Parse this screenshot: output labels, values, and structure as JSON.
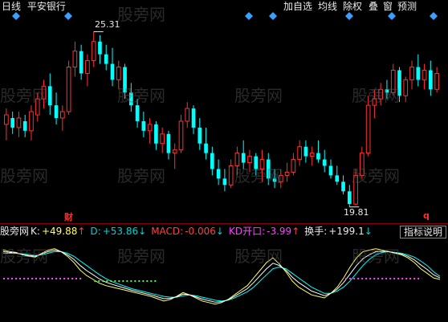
{
  "header": {
    "period_label": "日线",
    "stock_name": "平安银行",
    "buttons": [
      "加自选",
      "均线",
      "除权",
      "叠",
      "窗",
      "预测"
    ]
  },
  "price_marks": {
    "high_label": "25.31",
    "low_label": "19.81"
  },
  "signal_labels": {
    "left": "财",
    "right": "q"
  },
  "indicator": {
    "source": "股旁网",
    "k_label": "K:",
    "k_value": "+49.88",
    "d_label": "D:",
    "d_value": "+53.86",
    "macd_label": "MACD:",
    "macd_value": "-0.006",
    "kd_label": "KD开口:",
    "kd_value": "-3.99",
    "turnover_label": "换手:",
    "turnover_value": "+199.1",
    "explain_button": "指标说明"
  },
  "watermark": "股旁网",
  "colors": {
    "background": "#000000",
    "up_candle": "#ff3030",
    "down_candle": "#00ffff",
    "divider": "#8b0000",
    "diamond": "#3aa0ff",
    "k_line": "#ffffff",
    "d_line": "#ffff66",
    "j_line": "#00ffff",
    "bull_dots": "#ff40ff",
    "bear_dots": "#40ff40"
  },
  "chart_data": {
    "type": "candlestick",
    "price_range": [
      19.5,
      25.8
    ],
    "high": 25.31,
    "low": 19.81,
    "candles": [
      {
        "o": 22.4,
        "h": 22.9,
        "l": 21.9,
        "c": 22.7
      },
      {
        "o": 22.6,
        "h": 22.8,
        "l": 22.1,
        "c": 22.3
      },
      {
        "o": 22.3,
        "h": 22.8,
        "l": 22.0,
        "c": 22.6
      },
      {
        "o": 22.5,
        "h": 22.7,
        "l": 22.0,
        "c": 22.2
      },
      {
        "o": 22.2,
        "h": 23.0,
        "l": 21.9,
        "c": 22.8
      },
      {
        "o": 22.7,
        "h": 23.4,
        "l": 22.5,
        "c": 23.2
      },
      {
        "o": 23.2,
        "h": 23.8,
        "l": 22.9,
        "c": 23.6
      },
      {
        "o": 23.6,
        "h": 24.0,
        "l": 22.7,
        "c": 23.0
      },
      {
        "o": 23.0,
        "h": 23.4,
        "l": 22.4,
        "c": 22.6
      },
      {
        "o": 22.6,
        "h": 23.0,
        "l": 22.2,
        "c": 22.8
      },
      {
        "o": 22.8,
        "h": 24.4,
        "l": 22.7,
        "c": 24.2
      },
      {
        "o": 24.2,
        "h": 25.0,
        "l": 23.9,
        "c": 24.7
      },
      {
        "o": 24.7,
        "h": 24.9,
        "l": 23.8,
        "c": 24.0
      },
      {
        "o": 24.0,
        "h": 24.6,
        "l": 23.6,
        "c": 24.4
      },
      {
        "o": 24.4,
        "h": 25.31,
        "l": 24.2,
        "c": 25.0
      },
      {
        "o": 25.0,
        "h": 25.2,
        "l": 24.3,
        "c": 24.6
      },
      {
        "o": 24.6,
        "h": 24.9,
        "l": 24.1,
        "c": 24.3
      },
      {
        "o": 24.3,
        "h": 24.8,
        "l": 23.6,
        "c": 23.8
      },
      {
        "o": 23.8,
        "h": 24.4,
        "l": 23.5,
        "c": 24.2
      },
      {
        "o": 24.2,
        "h": 24.3,
        "l": 23.2,
        "c": 23.4
      },
      {
        "o": 23.4,
        "h": 23.7,
        "l": 22.8,
        "c": 23.0
      },
      {
        "o": 23.0,
        "h": 23.2,
        "l": 22.3,
        "c": 22.5
      },
      {
        "o": 22.5,
        "h": 22.8,
        "l": 22.0,
        "c": 22.2
      },
      {
        "o": 22.2,
        "h": 22.6,
        "l": 21.8,
        "c": 22.4
      },
      {
        "o": 22.4,
        "h": 22.5,
        "l": 21.6,
        "c": 21.8
      },
      {
        "o": 21.8,
        "h": 22.3,
        "l": 21.5,
        "c": 22.1
      },
      {
        "o": 22.1,
        "h": 22.2,
        "l": 21.3,
        "c": 21.5
      },
      {
        "o": 21.5,
        "h": 21.8,
        "l": 21.0,
        "c": 21.6
      },
      {
        "o": 21.6,
        "h": 22.7,
        "l": 21.5,
        "c": 22.5
      },
      {
        "o": 22.5,
        "h": 23.1,
        "l": 22.3,
        "c": 22.9
      },
      {
        "o": 22.9,
        "h": 23.0,
        "l": 22.1,
        "c": 22.3
      },
      {
        "o": 22.3,
        "h": 22.6,
        "l": 21.6,
        "c": 21.8
      },
      {
        "o": 21.8,
        "h": 22.3,
        "l": 21.3,
        "c": 21.5
      },
      {
        "o": 21.5,
        "h": 21.7,
        "l": 20.8,
        "c": 21.0
      },
      {
        "o": 21.0,
        "h": 21.3,
        "l": 20.5,
        "c": 20.7
      },
      {
        "o": 20.7,
        "h": 21.0,
        "l": 20.3,
        "c": 20.5
      },
      {
        "o": 20.5,
        "h": 21.3,
        "l": 20.4,
        "c": 21.1
      },
      {
        "o": 21.1,
        "h": 21.7,
        "l": 20.8,
        "c": 21.5
      },
      {
        "o": 21.5,
        "h": 21.9,
        "l": 21.0,
        "c": 21.2
      },
      {
        "o": 21.2,
        "h": 21.6,
        "l": 20.9,
        "c": 21.4
      },
      {
        "o": 21.4,
        "h": 21.5,
        "l": 20.8,
        "c": 21.0
      },
      {
        "o": 21.0,
        "h": 21.6,
        "l": 20.6,
        "c": 21.3
      },
      {
        "o": 21.3,
        "h": 21.5,
        "l": 20.5,
        "c": 20.7
      },
      {
        "o": 20.7,
        "h": 21.0,
        "l": 20.4,
        "c": 20.6
      },
      {
        "o": 20.6,
        "h": 21.0,
        "l": 20.4,
        "c": 20.8
      },
      {
        "o": 20.8,
        "h": 21.2,
        "l": 20.6,
        "c": 20.9
      },
      {
        "o": 20.9,
        "h": 21.5,
        "l": 20.8,
        "c": 21.3
      },
      {
        "o": 21.3,
        "h": 21.9,
        "l": 21.1,
        "c": 21.7
      },
      {
        "o": 21.7,
        "h": 21.9,
        "l": 21.2,
        "c": 21.4
      },
      {
        "o": 21.4,
        "h": 21.7,
        "l": 21.1,
        "c": 21.5
      },
      {
        "o": 21.5,
        "h": 21.9,
        "l": 21.2,
        "c": 21.3
      },
      {
        "o": 21.3,
        "h": 21.6,
        "l": 20.9,
        "c": 21.1
      },
      {
        "o": 21.1,
        "h": 21.3,
        "l": 20.7,
        "c": 20.8
      },
      {
        "o": 20.8,
        "h": 21.1,
        "l": 20.5,
        "c": 20.6
      },
      {
        "o": 20.6,
        "h": 20.8,
        "l": 20.2,
        "c": 20.3
      },
      {
        "o": 20.3,
        "h": 20.5,
        "l": 19.81,
        "c": 19.9
      },
      {
        "o": 19.9,
        "h": 21.0,
        "l": 19.85,
        "c": 20.8
      },
      {
        "o": 20.8,
        "h": 21.7,
        "l": 20.7,
        "c": 21.5
      },
      {
        "o": 21.5,
        "h": 23.3,
        "l": 21.4,
        "c": 23.0
      },
      {
        "o": 23.0,
        "h": 23.5,
        "l": 22.6,
        "c": 23.2
      },
      {
        "o": 23.2,
        "h": 23.7,
        "l": 23.0,
        "c": 23.5
      },
      {
        "o": 23.5,
        "h": 23.8,
        "l": 23.2,
        "c": 23.4
      },
      {
        "o": 23.4,
        "h": 24.3,
        "l": 23.3,
        "c": 24.1
      },
      {
        "o": 24.1,
        "h": 24.2,
        "l": 23.1,
        "c": 23.3
      },
      {
        "o": 23.3,
        "h": 23.9,
        "l": 23.1,
        "c": 23.8
      },
      {
        "o": 23.8,
        "h": 24.4,
        "l": 23.5,
        "c": 24.2
      },
      {
        "o": 24.2,
        "h": 24.6,
        "l": 23.6,
        "c": 23.8
      },
      {
        "o": 23.8,
        "h": 24.3,
        "l": 23.5,
        "c": 24.1
      },
      {
        "o": 24.1,
        "h": 24.4,
        "l": 23.3,
        "c": 23.5
      },
      {
        "o": 23.5,
        "h": 24.2,
        "l": 23.4,
        "c": 24.0
      }
    ],
    "kdj": {
      "k": [
        88,
        86,
        85,
        82,
        80,
        79,
        84,
        88,
        90,
        86,
        80,
        72,
        62,
        55,
        50,
        45,
        42,
        40,
        38,
        36,
        34,
        32,
        30,
        28,
        25,
        22,
        24,
        28,
        33,
        30,
        26,
        22,
        20,
        18,
        20,
        24,
        30,
        36,
        42,
        52,
        62,
        72,
        78,
        70,
        60,
        48,
        40,
        35,
        30,
        28,
        26,
        32,
        40,
        52,
        66,
        78,
        86,
        88,
        90,
        88,
        86,
        84,
        82,
        78,
        72,
        64,
        58,
        52,
        50
      ],
      "d": [
        84,
        84,
        84,
        83,
        82,
        81,
        82,
        84,
        86,
        86,
        84,
        80,
        74,
        68,
        62,
        56,
        51,
        47,
        44,
        41,
        38,
        36,
        34,
        32,
        30,
        28,
        27,
        27,
        29,
        30,
        29,
        27,
        25,
        23,
        22,
        23,
        26,
        30,
        34,
        40,
        48,
        56,
        64,
        66,
        64,
        58,
        52,
        46,
        40,
        36,
        32,
        32,
        35,
        40,
        48,
        58,
        68,
        76,
        82,
        85,
        86,
        85,
        84,
        82,
        79,
        74,
        68,
        60,
        54
      ]
    },
    "bull_zones": [
      [
        0,
        22
      ],
      [
        94,
        115
      ]
    ],
    "bear_zone": [
      25,
      42
    ]
  }
}
